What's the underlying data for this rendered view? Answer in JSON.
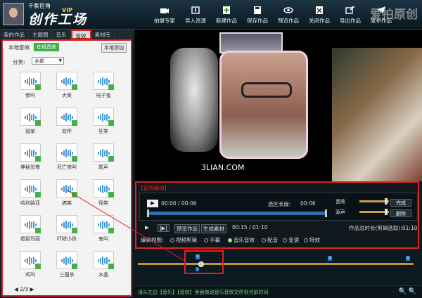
{
  "app": {
    "username": "千紫巨角",
    "vip": "VIP",
    "logo": "创作工场",
    "brand_mark": "爱拍原创"
  },
  "toolbar": [
    {
      "label": "拍摄专家",
      "icon": "camera-icon"
    },
    {
      "label": "导入资源",
      "icon": "import-icon"
    },
    {
      "label": "新建作品",
      "icon": "new-icon"
    },
    {
      "label": "保存作品",
      "icon": "save-icon"
    },
    {
      "label": "预览作品",
      "icon": "eye-icon"
    },
    {
      "label": "关闭作品",
      "icon": "close-icon"
    },
    {
      "label": "导出作品",
      "icon": "export-icon"
    },
    {
      "label": "发布作品",
      "icon": "publish-icon"
    }
  ],
  "tabs": [
    "我的作品",
    "主题图",
    "音乐",
    "音效",
    "素材库"
  ],
  "active_tab": "音效",
  "panel": {
    "local": "本地音效",
    "online": "在线音效",
    "local_add": "本地添加",
    "category_label": "分类:",
    "category_value": "全部",
    "pager": "◀ 2/3 ▶"
  },
  "effects": [
    "惨叫",
    "大笑",
    "电子鬼",
    "鼓掌",
    "欢呼",
    "狂笑",
    "神秘恐怖",
    "死亡惨叫",
    "尾声",
    "哈利路亚",
    "搞笑",
    "怪笑",
    "超级玛丽",
    "吓唬小孩",
    "鬼叫",
    "鸡叫",
    "三国杀",
    "水晶"
  ],
  "preview": {
    "watermark": "3LIAN.COM"
  },
  "editor": {
    "title": "【音效编辑】",
    "play": "▶",
    "time": "00:00 / 00:06",
    "sel_len_label": "选区长度:",
    "sel_len": "00:06",
    "volume_label": "音效",
    "volume_level": 0.95,
    "fade_label": "源声",
    "fade_level": 0.95,
    "done": "完成",
    "delete": "删除",
    "ctrl_play": "▶",
    "ctrl_frame": "|▶|",
    "preview_work": "预览作品",
    "gen_material": "生成素材",
    "ctrl_time": "00:15 / 01:10",
    "total_label": "作品总时长(剪辑选取):01:10",
    "mode_label": "编辑视图:",
    "modes": [
      "视频剪辑",
      "字幕",
      "音乐音效",
      "配音",
      "变速",
      "特效"
    ],
    "active_mode": "音乐音效"
  },
  "timeline": {
    "status": "请从左边【音乐】【音效】里面拖动音乐音效文件到当前时间"
  }
}
